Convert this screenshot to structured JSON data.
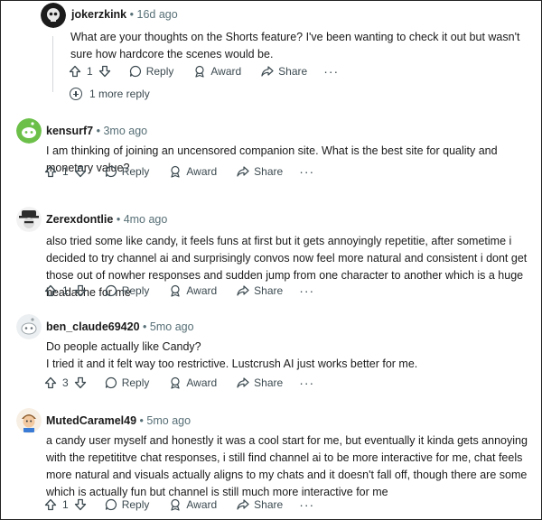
{
  "comments": [
    {
      "author": "jokerzkink",
      "age": "16d ago",
      "body": [
        "What are your thoughts on the Shorts feature? I've been wanting to check it out but wasn't sure how hardcore the scenes would be."
      ],
      "votes": "1",
      "avatar_icon": "skull-avatar-icon"
    },
    {
      "author": "kensurf7",
      "age": "3mo ago",
      "body": [
        "I am thinking of joining an uncensored companion site. What is the best site for quality and monetary value?"
      ],
      "votes": "1",
      "avatar_icon": "green-snoo-avatar-icon"
    },
    {
      "author": "Zerexdontlie",
      "age": "4mo ago",
      "body": [
        "also tried some like candy, it feels funs at first but it gets annoyingly repetitie, after sometime i decided to try channel ai and surprisingly convos now feel more natural and consistent i dont get those out of nowher responses and sudden jump from one character to another which is a huge headache for me"
      ],
      "votes": "1",
      "avatar_icon": "hat-avatar-icon"
    },
    {
      "author": "ben_claude69420",
      "age": "5mo ago",
      "body": [
        "Do people actually like Candy?",
        "I tried it and it felt way too restrictive. Lustcrush AI just works better for me."
      ],
      "votes": "3",
      "avatar_icon": "grey-snoo-avatar-icon"
    },
    {
      "author": "MutedCaramel49",
      "age": "5mo ago",
      "body": [
        "a candy user myself and honestly it was a cool start for me, but eventually it kinda gets annoying with the repetititve chat responses, i still find channel ai to be more interactive for me, chat feels more natural and visuals actually aligns to my chats and it doesn't fall off, though there are some which is actually fun but channel is still much more interactive for me"
      ],
      "votes": "1",
      "avatar_icon": "cartoon-avatar-icon"
    }
  ],
  "labels": {
    "separator": "•",
    "reply": "Reply",
    "award": "Award",
    "share": "Share",
    "more_dots": "···",
    "more_replies": "1 more reply"
  }
}
